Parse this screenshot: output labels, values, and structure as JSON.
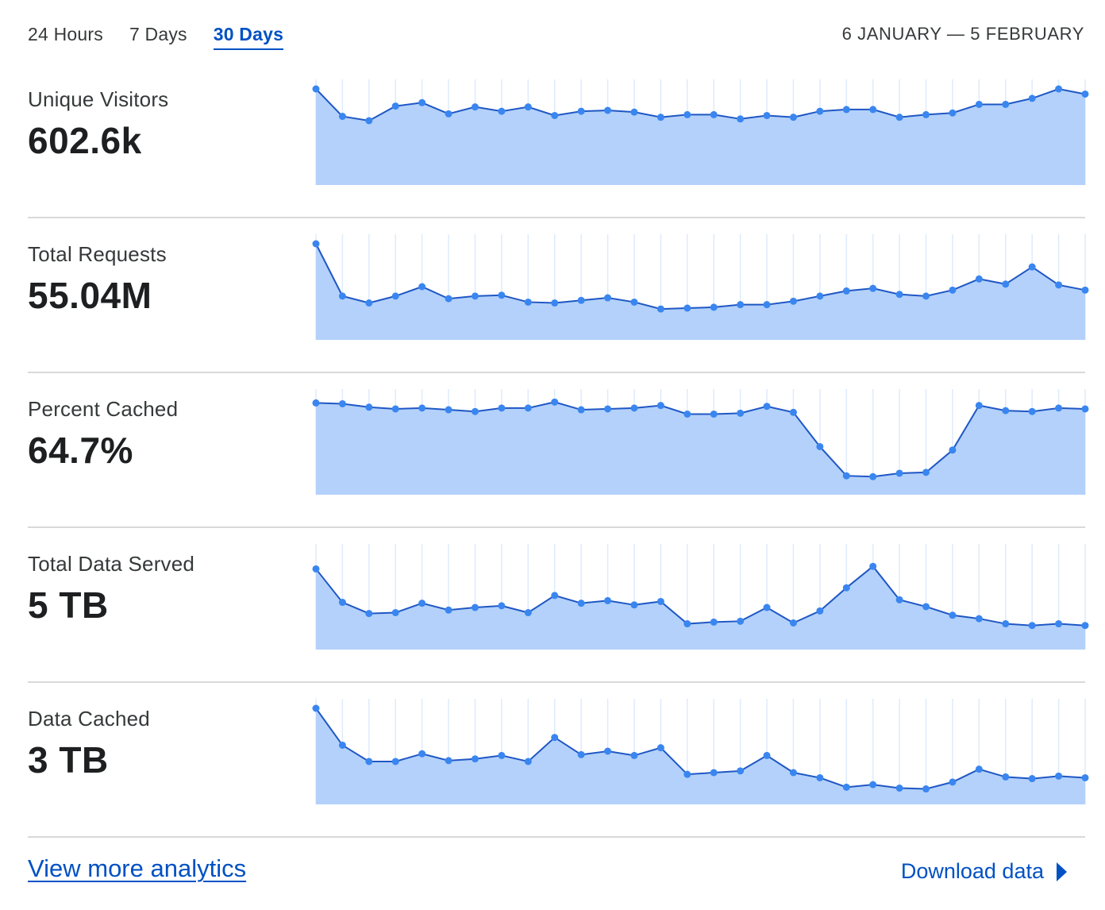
{
  "time_tabs": [
    {
      "label": "24 Hours",
      "active": false
    },
    {
      "label": "7 Days",
      "active": false
    },
    {
      "label": "30 Days",
      "active": true
    }
  ],
  "date_range": "6 JANUARY — 5 FEBRUARY",
  "colors": {
    "accent": "#0051c3",
    "line": "#1f57c4",
    "point": "#3a86f0",
    "area": "#b3d1fa",
    "gridline": "#deebfb",
    "divider": "#d9d9d9"
  },
  "metrics": [
    {
      "label": "Unique Visitors",
      "value": "602.6k"
    },
    {
      "label": "Total Requests",
      "value": "55.04M"
    },
    {
      "label": "Percent Cached",
      "value": "64.7%"
    },
    {
      "label": "Total Data Served",
      "value": "5 TB"
    },
    {
      "label": "Data Cached",
      "value": "3 TB"
    }
  ],
  "chart_data": [
    {
      "type": "area",
      "metric": "Unique Visitors",
      "values": [
        100,
        68,
        63,
        80,
        84,
        71,
        79,
        74,
        79,
        69,
        74,
        75,
        73,
        67,
        70,
        70,
        65,
        69,
        67,
        74,
        76,
        76,
        67,
        70,
        72,
        82,
        82,
        89,
        100,
        94
      ]
    },
    {
      "type": "area",
      "metric": "Total Requests",
      "values": [
        100,
        39,
        31,
        39,
        50,
        36,
        39,
        40,
        32,
        31,
        34,
        37,
        32,
        24,
        25,
        26,
        29,
        29,
        33,
        39,
        45,
        48,
        41,
        39,
        46,
        59,
        53,
        73,
        52,
        46
      ]
    },
    {
      "type": "area",
      "metric": "Percent Cached",
      "values": [
        95,
        94,
        90,
        88,
        89,
        87,
        85,
        89,
        89,
        96,
        87,
        88,
        89,
        92,
        82,
        82,
        83,
        91,
        84,
        44,
        10,
        9,
        13,
        14,
        40,
        92,
        86,
        85,
        89,
        88
      ]
    },
    {
      "type": "area",
      "metric": "Total Data Served",
      "values": [
        82,
        43,
        30,
        31,
        42,
        34,
        37,
        39,
        31,
        51,
        42,
        45,
        40,
        44,
        18,
        20,
        21,
        37,
        19,
        33,
        60,
        85,
        46,
        38,
        28,
        24,
        18,
        16,
        18,
        16
      ]
    },
    {
      "type": "area",
      "metric": "Data Cached",
      "values": [
        100,
        57,
        38,
        38,
        47,
        39,
        41,
        45,
        38,
        66,
        46,
        50,
        45,
        54,
        23,
        25,
        27,
        45,
        25,
        19,
        8,
        11,
        7,
        6,
        14,
        29,
        20,
        18,
        21,
        19
      ]
    }
  ],
  "footer": {
    "more_link": "View more analytics",
    "download_link": "Download data"
  }
}
